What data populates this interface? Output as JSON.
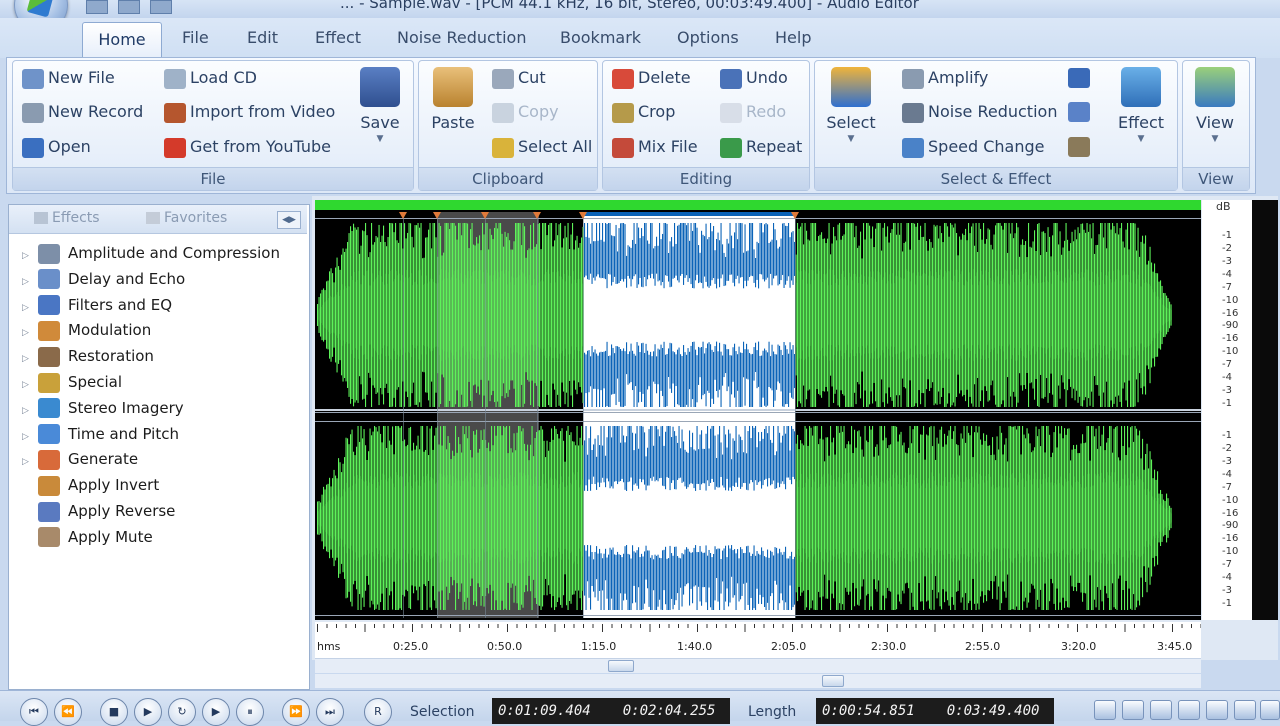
{
  "window": {
    "title": "... - Sample.wav - [PCM 44.1 kHz, 16 bit, Stereo, 00:03:49.400] - Audio Editor"
  },
  "tabs": [
    "Home",
    "File",
    "Edit",
    "Effect",
    "Noise Reduction",
    "Bookmark",
    "Options",
    "Help"
  ],
  "ribbon": {
    "file_group": {
      "label": "File",
      "new_file": "New File",
      "new_record": "New Record",
      "open": "Open",
      "load_cd": "Load CD",
      "import_video": "Import from Video",
      "youtube": "Get from YouTube",
      "save": "Save"
    },
    "clipboard_group": {
      "label": "Clipboard",
      "paste": "Paste",
      "cut": "Cut",
      "copy": "Copy",
      "select_all": "Select All"
    },
    "editing_group": {
      "label": "Editing",
      "delete": "Delete",
      "crop": "Crop",
      "mix_file": "Mix File",
      "undo": "Undo",
      "redo": "Redo",
      "repeat": "Repeat"
    },
    "select_effect_group": {
      "label": "Select & Effect",
      "select": "Select",
      "amplify": "Amplify",
      "noise_reduction": "Noise Reduction",
      "speed_change": "Speed Change",
      "effect": "Effect"
    },
    "view_group": {
      "label": "View",
      "view": "View"
    }
  },
  "left_panel": {
    "tabs": [
      "Effects",
      "Favorites"
    ],
    "items": [
      {
        "label": "Amplitude and Compression",
        "icon": "amplitude-icon",
        "color": "#7d8fa8"
      },
      {
        "label": "Delay and Echo",
        "icon": "echo-icon",
        "color": "#6a8fc9"
      },
      {
        "label": "Filters and EQ",
        "icon": "filter-icon",
        "color": "#4a76c4"
      },
      {
        "label": "Modulation",
        "icon": "modulation-icon",
        "color": "#d08a3a"
      },
      {
        "label": "Restoration",
        "icon": "restoration-icon",
        "color": "#8a6a4a"
      },
      {
        "label": "Special",
        "icon": "special-icon",
        "color": "#c9a13a"
      },
      {
        "label": "Stereo Imagery",
        "icon": "stereo-icon",
        "color": "#3a8ad0"
      },
      {
        "label": "Time and Pitch",
        "icon": "time-pitch-icon",
        "color": "#4a8ad8"
      },
      {
        "label": "Generate",
        "icon": "generate-icon",
        "color": "#d86a3a"
      },
      {
        "label": "Apply Invert",
        "icon": "invert-icon",
        "color": "#c98a3a"
      },
      {
        "label": "Apply Reverse",
        "icon": "reverse-icon",
        "color": "#5a7ac0"
      },
      {
        "label": "Apply Mute",
        "icon": "mute-icon",
        "color": "#a88a6a"
      }
    ]
  },
  "waveform": {
    "db_label": "dB",
    "db_ticks_top": [
      "-1",
      "-2",
      "-3",
      "-4",
      "-7",
      "-10",
      "-16",
      "-90",
      "-16",
      "-10",
      "-7",
      "-4",
      "-3",
      "-1"
    ],
    "db_ticks_bottom": [
      "-1",
      "-2",
      "-3",
      "-4",
      "-7",
      "-10",
      "-16",
      "-90",
      "-16",
      "-10",
      "-7",
      "-4",
      "-3",
      "-1"
    ],
    "colors": {
      "wave": "#5ef25a",
      "selection_bg": "#ffffff",
      "selection_wave": "#0b63b8",
      "background": "#000000",
      "marked": "#4a4a4a"
    }
  },
  "timeline": {
    "labels": [
      "hms",
      "0:25.0",
      "0:50.0",
      "1:15.0",
      "1:40.0",
      "2:05.0",
      "2:30.0",
      "2:55.0",
      "3:20.0",
      "3:45.0"
    ]
  },
  "transport": {
    "selection_label": "Selection",
    "selection_start": "0:01:09.404",
    "selection_end": "0:02:04.255",
    "length_label": "Length",
    "length_value": "0:00:54.851",
    "total_length": "0:03:49.400"
  }
}
